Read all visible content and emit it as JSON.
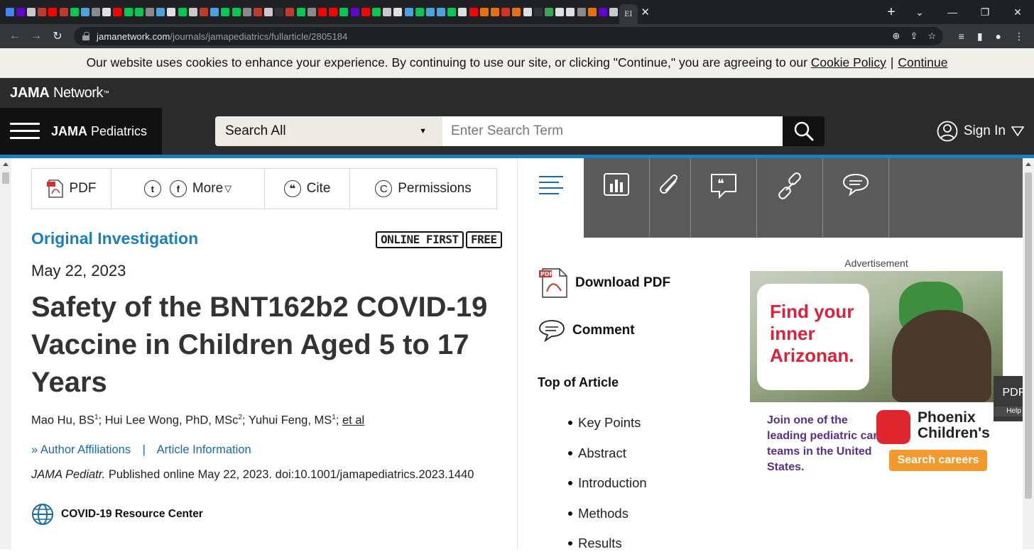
{
  "browser": {
    "url_domain": "jamanetwork.com",
    "url_path": "/journals/jamapediatrics/fullarticle/2805184",
    "tab_colors": [
      "#4285f4",
      "#6001d2",
      "#c9c9c9",
      "#c0392b",
      "#ff0000",
      "#c0392b",
      "#00c853",
      "#4aa3df",
      "#8a8a8a",
      "#e0e0e0",
      "#ff0000",
      "#00c853",
      "#00c853",
      "#8a8a8a",
      "#4aa3df",
      "#e0e0e0",
      "#00c853",
      "#c9c9c9",
      "#c0392b",
      "#4aa3df",
      "#00c853",
      "#00c853",
      "#8a8a8a",
      "#c0392b",
      "#c9c9c9",
      "#333333",
      "#c0392b",
      "#00c853",
      "#8a8a8a",
      "#ff0000",
      "#ff0000",
      "#00c853",
      "#6001d2",
      "#ff0000",
      "#00c853",
      "#c9c9c9",
      "#e0e0e0",
      "#4aa3df",
      "#00c853",
      "#4aa3df",
      "#4aa3df",
      "#00c853",
      "#e0e0e0",
      "#ff0000",
      "#e8710a",
      "#e8710a",
      "#d93025",
      "#e8710a",
      "#e0e0e0",
      "#333333",
      "#34a853",
      "#e0e0e0",
      "#e0e0e0",
      "#8a8a8a",
      "#e8710a",
      "#6001d2",
      "#c9c9c9"
    ],
    "active_tab_label": "EI"
  },
  "cookie": {
    "message": "Our website uses cookies to enhance your experience. By continuing to use our site, or clicking \"Continue,\" you are agreeing to our",
    "policy_link": "Cookie Policy",
    "separator": "|",
    "continue_link": "Continue"
  },
  "network": {
    "brand_bold": "JAMA",
    "brand_light": "Network",
    "tm": "™"
  },
  "nav": {
    "journal_bold": "JAMA",
    "journal_rest": " Pediatrics",
    "search_scope": "Search All",
    "search_placeholder": "Enter Search Term",
    "signin_label": "Sign In"
  },
  "actions": {
    "pdf": "PDF",
    "twitter": "t",
    "facebook": "f",
    "more": "More",
    "cite": "Cite",
    "cite_icon": "❝",
    "permissions": "Permissions",
    "copyright": "C"
  },
  "article": {
    "type": "Original Investigation",
    "badge_online": "ONLINE FIRST",
    "badge_free": "FREE",
    "date": "May 22, 2023",
    "title": "Safety of the BNT162b2 COVID-19 Vaccine in Children Aged 5 to 17 Years",
    "authors": [
      {
        "name": "Mao Hu, BS",
        "sup": "1",
        "sep": "; "
      },
      {
        "name": "Hui Lee Wong, PhD, MSc",
        "sup": "2",
        "sep": "; "
      },
      {
        "name": "Yuhui Feng, MS",
        "sup": "1",
        "sep": "; "
      }
    ],
    "et_al": "et al",
    "author_affiliations": "Author Affiliations",
    "aff_separator": "|",
    "article_information": "Article Information",
    "journal_abbrev": "JAMA Pediatr.",
    "citation": " Published online May 22, 2023. doi:10.1001/jamapediatrics.2023.1440",
    "resource_center": "COVID-19 Resource Center"
  },
  "sidebar": {
    "download_pdf": "Download PDF",
    "comment": "Comment",
    "toc_heading": "Top of Article",
    "toc_items": [
      "Key Points",
      "Abstract",
      "Introduction",
      "Methods",
      "Results"
    ]
  },
  "ad": {
    "label": "Advertisement",
    "headline": "Find your inner Arizonan.",
    "body": "Join one of the leading pediatric care teams in the United States.",
    "brand": "Phoenix Children's",
    "cta": "Search careers"
  },
  "floating": {
    "pdf": "PDF",
    "help": "Help"
  }
}
